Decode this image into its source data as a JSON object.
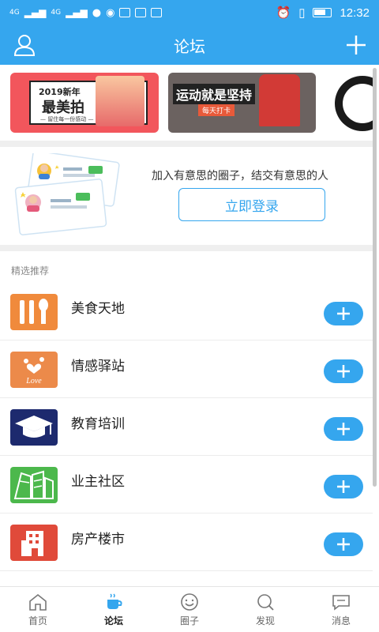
{
  "status_bar": {
    "signal1": "4G",
    "signal2": "4G",
    "time": "12:32"
  },
  "header": {
    "title": "论坛"
  },
  "banners": [
    {
      "line1": "2019新年",
      "line2": "最美拍",
      "line3": "— 留住每一份感动 —"
    },
    {
      "line1": "运动就是坚持",
      "line2": "每天打卡"
    }
  ],
  "login": {
    "description": "加入有意思的圈子，结交有意思的人",
    "button_label": "立即登录"
  },
  "recommend": {
    "header": "精选推荐",
    "items": [
      {
        "label": "美食天地",
        "icon": "utensils-icon"
      },
      {
        "label": "情感驿站",
        "icon": "love-hearts-icon"
      },
      {
        "label": "教育培训",
        "icon": "graduation-cap-icon"
      },
      {
        "label": "业主社区",
        "icon": "buildings-icon"
      },
      {
        "label": "房产楼市",
        "icon": "apartment-icon"
      }
    ]
  },
  "tabs": [
    {
      "label": "首页",
      "icon": "home-icon"
    },
    {
      "label": "论坛",
      "icon": "cup-icon",
      "active": true
    },
    {
      "label": "圈子",
      "icon": "smile-icon"
    },
    {
      "label": "发现",
      "icon": "search-icon"
    },
    {
      "label": "消息",
      "icon": "message-icon"
    }
  ],
  "colors": {
    "primary": "#35a6ee",
    "divider": "#efefef"
  }
}
